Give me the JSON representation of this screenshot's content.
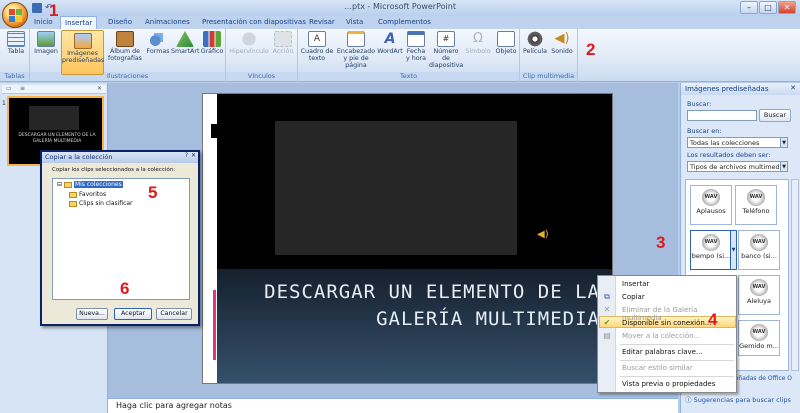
{
  "app": {
    "title": "…ptx - Microsoft PowerPoint",
    "window_controls": [
      "–",
      "□",
      "✕"
    ]
  },
  "tabs": [
    "Inicio",
    "Insertar",
    "Diseño",
    "Animaciones",
    "Presentación con diapositivas",
    "Revisar",
    "Vista",
    "Complementos"
  ],
  "active_tab": "Insertar",
  "ribbon": {
    "groups": [
      "Tablas",
      "Ilustraciones",
      "Vínculos",
      "Texto",
      "Clip multimedia"
    ],
    "buttons": {
      "tabla": "Tabla",
      "imagen": "Imagen",
      "imagenes_pred": "Imágenes prediseñadas",
      "album": "Álbum de fotografías",
      "formas": "Formas",
      "smartart": "SmartArt",
      "grafico": "Gráfico",
      "hipervinculo": "Hipervínculo",
      "accion": "Acción",
      "cuadro_texto": "Cuadro de texto",
      "encabezado": "Encabezado y pie de página",
      "wordart": "WordArt",
      "fecha": "Fecha y hora",
      "numero": "Número de diapositiva",
      "simbolo": "Símbolo",
      "objeto": "Objeto",
      "pelicula": "Película",
      "sonido": "Sonido"
    }
  },
  "slide": {
    "title": "DESCARGAR UN ELEMENTO DE LA GALERÍA MULTIMEDIA"
  },
  "thumbnail": {
    "number": "1",
    "title": "DESCARGAR UN ELEMENTO DE LA GALERÍA MULTIMEDIA"
  },
  "notes_placeholder": "Haga clic para agregar notas",
  "clip_pane": {
    "header": "Imágenes prediseñadas",
    "search_label": "Buscar:",
    "search_value": "",
    "search_button": "Buscar",
    "search_in_label": "Buscar en:",
    "search_in_value": "Todas las colecciones",
    "results_label": "Los resultados deben ser:",
    "results_value": "Tipos de archivos multimedia se",
    "clips": [
      "Aplausos",
      "Teléfono",
      "bempo (si...",
      "banco (si...",
      "",
      "Aleluya",
      "",
      "Gemido m..."
    ],
    "clip_badge": "WAV",
    "footer_links": [
      "Imágenes prediseñadas de Office O",
      "Sugerencias para buscar clips"
    ]
  },
  "context_menu": {
    "items": [
      {
        "label": "Insertar",
        "disabled": false
      },
      {
        "label": "Copiar",
        "disabled": false
      },
      {
        "label": "Eliminar de la Galería multimedia",
        "disabled": true
      },
      {
        "label": "Disponible sin conexión...",
        "disabled": false,
        "highlighted": true
      },
      {
        "label": "Mover a la colección...",
        "disabled": true
      },
      {
        "label": "Editar palabras clave...",
        "disabled": false
      },
      {
        "label": "Buscar estilo similar",
        "disabled": true
      },
      {
        "label": "Vista previa o propiedades",
        "disabled": false
      }
    ]
  },
  "dialog": {
    "title": "Copiar a la colección",
    "prompt": "Copiar los clips seleccionados a la colección:",
    "tree": [
      "Mis colecciones",
      "Favoritos",
      "Clips sin clasificar"
    ],
    "buttons": [
      "Nueva...",
      "Aceptar",
      "Cancelar"
    ]
  },
  "step_numbers": [
    "1",
    "2",
    "3",
    "4",
    "5",
    "6"
  ],
  "colors": {
    "accent": "#e1191a",
    "ribbon_blue": "#15428b",
    "highlight": "#ffd77a"
  }
}
